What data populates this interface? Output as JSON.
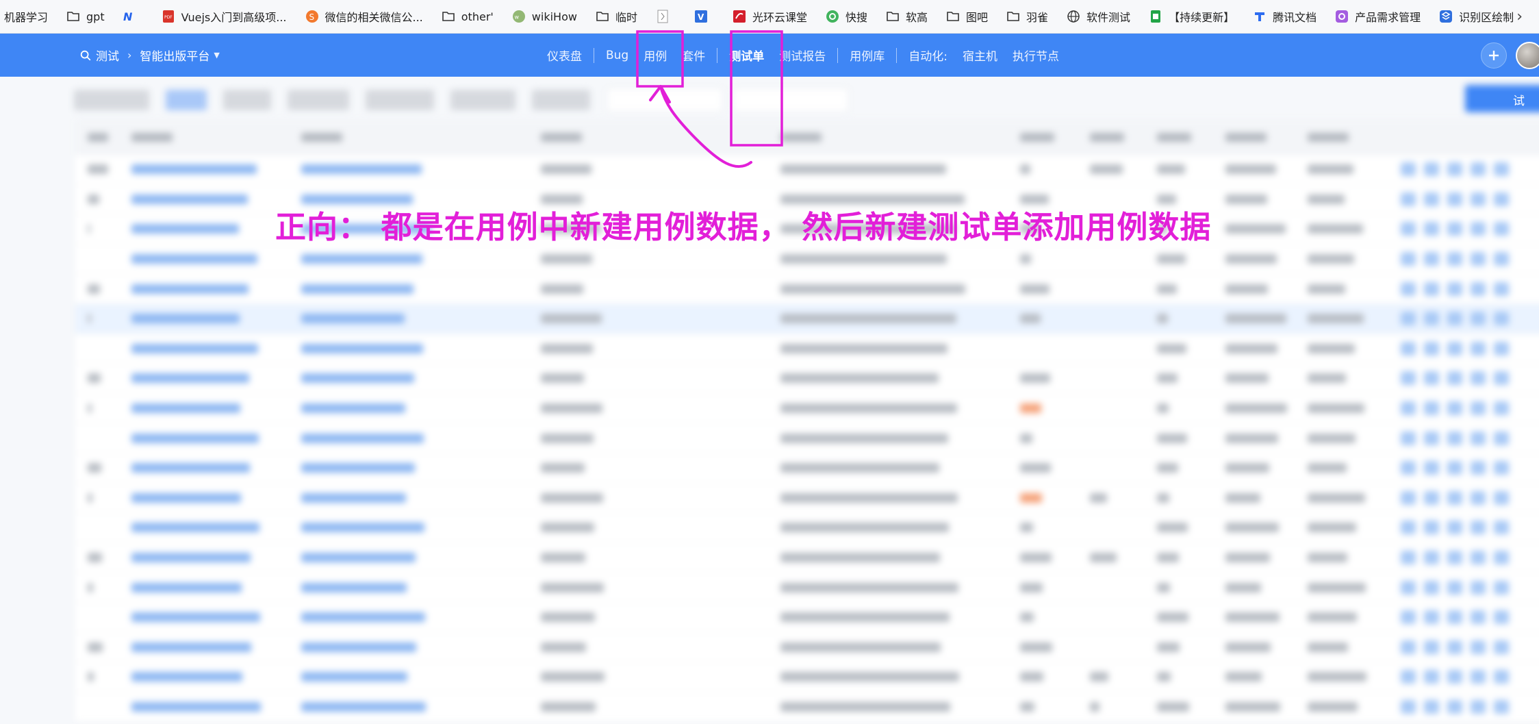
{
  "bookmarks": [
    {
      "label": "机器学习",
      "icon": "none"
    },
    {
      "label": "gpt",
      "icon": "folder-icon"
    },
    {
      "label": "",
      "icon": "n-logo-icon"
    },
    {
      "label": "Vuejs入门到高级项...",
      "icon": "pdf-icon"
    },
    {
      "label": "微信的相关微信公...",
      "icon": "s-logo-icon"
    },
    {
      "label": "other'",
      "icon": "folder-icon"
    },
    {
      "label": "wikiHow",
      "icon": "wikihow-icon"
    },
    {
      "label": "临时",
      "icon": "folder-icon"
    },
    {
      "label": "",
      "icon": "page-icon"
    },
    {
      "label": "",
      "icon": "v-logo-icon"
    },
    {
      "label": "光环云课堂",
      "icon": "red-logo-icon"
    },
    {
      "label": "快搜",
      "icon": "q-logo-icon"
    },
    {
      "label": "软高",
      "icon": "folder-icon"
    },
    {
      "label": "图吧",
      "icon": "folder-icon"
    },
    {
      "label": "羽雀",
      "icon": "folder-icon"
    },
    {
      "label": "软件测试",
      "icon": "globe-icon"
    },
    {
      "label": "【持续更新】",
      "icon": "sheet-icon"
    },
    {
      "label": "腾讯文档",
      "icon": "tencent-doc-icon"
    },
    {
      "label": "产品需求管理",
      "icon": "purple-logo-icon"
    },
    {
      "label": "识别区绘制",
      "icon": "blue-logo-icon"
    }
  ],
  "nav": {
    "breadcrumb_root": "测试",
    "breadcrumb_project": "智能出版平台",
    "menu": [
      "仪表盘",
      "Bug",
      "用例",
      "套件",
      "测试单",
      "测试报告",
      "用例库",
      "自动化:",
      "宿主机",
      "执行节点"
    ],
    "active_menu": "测试单"
  },
  "toolbar": {
    "right_button_fragment": "试"
  },
  "annotation": {
    "text": "正向： 都是在用例中新建用例数据， 然后新建测试单添加用例数据",
    "color": "#e21fd8",
    "boxes": [
      "用例",
      "测试单"
    ]
  },
  "colors": {
    "nav_bg": "#3f86f5",
    "annotation": "#e21fd8",
    "link_blue": "#8db7f2"
  }
}
